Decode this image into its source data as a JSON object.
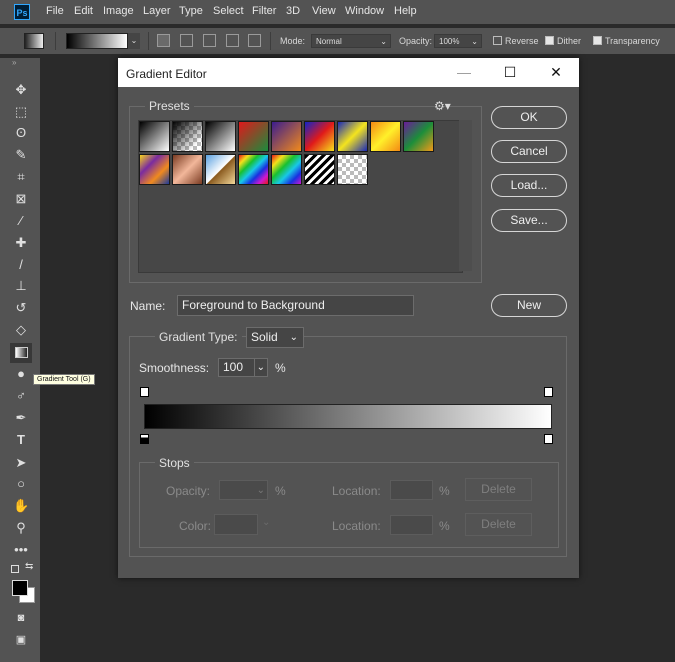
{
  "app": {
    "logo": "Ps",
    "menu": [
      "File",
      "Edit",
      "Image",
      "Layer",
      "Type",
      "Select",
      "Filter",
      "3D",
      "View",
      "Window",
      "Help"
    ]
  },
  "options_bar": {
    "mode_label": "Mode:",
    "mode_value": "Normal",
    "opacity_label": "Opacity:",
    "opacity_value": "100%",
    "reverse_label": "Reverse",
    "dither_label": "Dither",
    "transparency_label": "Transparency",
    "reverse_checked": false,
    "dither_checked": true,
    "transparency_checked": true
  },
  "tooltip": {
    "text": "Gradient Tool (G)"
  },
  "dialog": {
    "title": "Gradient Editor",
    "presets": {
      "label": "Presets",
      "items": [
        "foreground-to-background",
        "foreground-to-transparent",
        "black-to-white",
        "red-green",
        "violet-orange",
        "blue-red-yellow",
        "blue-yellow-blue",
        "orange-yellow-orange",
        "violet-green-orange",
        "yellow-violet-orange-blue",
        "copper",
        "chrome",
        "spectrum",
        "transparent-rainbow",
        "transparent-stripes",
        "neutral-density"
      ]
    },
    "buttons": {
      "ok": "OK",
      "cancel": "Cancel",
      "load": "Load...",
      "save": "Save...",
      "new": "New"
    },
    "name_label": "Name:",
    "name_value": "Foreground to Background",
    "gradient_type_label": "Gradient Type:",
    "gradient_type_value": "Solid",
    "smoothness_label": "Smoothness:",
    "smoothness_value": "100",
    "percent": "%",
    "gradient": {
      "start_color": "#000000",
      "end_color": "#ffffff"
    },
    "stops": {
      "label": "Stops",
      "opacity_label": "Opacity:",
      "color_label": "Color:",
      "location_label": "Location:",
      "delete_label": "Delete"
    }
  }
}
